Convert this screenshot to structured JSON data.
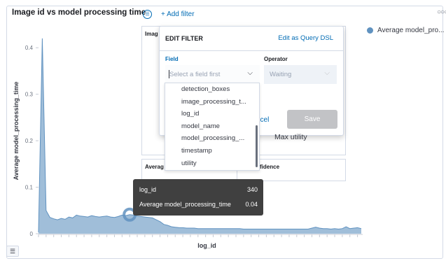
{
  "panel": {
    "title": "Image id vs model processing time",
    "dots": "○○○",
    "legend_toggle_icon": "list-icon"
  },
  "legend": {
    "label": "Average model_pro...",
    "color": "#6092c0"
  },
  "filter_bar": {
    "menu_icon": "filter-menu-icon",
    "add_filter": "+ Add filter"
  },
  "background_panels": {
    "top_left_title": "Imag",
    "bottom_left_title": "Averag",
    "bottom_right_title": "ge_confidence",
    "max_utility": "Max utility"
  },
  "edit_filter": {
    "title": "EDIT FILTER",
    "edit_dsl": "Edit as Query DSL",
    "field_label": "Field",
    "field_placeholder": "Select a field first",
    "operator_label": "Operator",
    "operator_placeholder": "Waiting",
    "cancel": "ncel",
    "save": "Save",
    "options": [
      "detection_boxes",
      "image_processing_t...",
      "log_id",
      "model_name",
      "model_processing_...",
      "timestamp",
      "utility"
    ]
  },
  "tooltip": {
    "row1_label": "log_id",
    "row1_value": "340",
    "row2_label": "Average model_processing_time",
    "row2_value": "0.04"
  },
  "chart_data": {
    "type": "area",
    "title": "Image id vs model processing time",
    "xlabel": "log_id",
    "ylabel": "Average model_processing_time",
    "ylim": [
      0,
      0.45
    ],
    "yticks": [
      0,
      0.1,
      0.2,
      0.3,
      0.4
    ],
    "series": [
      {
        "name": "Average model_processing_time",
        "values": [
          0.003,
          0.42,
          0.05,
          0.035,
          0.032,
          0.03,
          0.033,
          0.031,
          0.036,
          0.034,
          0.04,
          0.038,
          0.037,
          0.036,
          0.039,
          0.037,
          0.036,
          0.037,
          0.038,
          0.036,
          0.035,
          0.037,
          0.04,
          0.039,
          0.041,
          0.04,
          0.038,
          0.037,
          0.036,
          0.035,
          0.034,
          0.03,
          0.026,
          0.02,
          0.018,
          0.015,
          0.014,
          0.013,
          0.013,
          0.012,
          0.012,
          0.012,
          0.011,
          0.011,
          0.011,
          0.011,
          0.011,
          0.011,
          0.011,
          0.011,
          0.011,
          0.011,
          0.011,
          0.011,
          0.01,
          0.01,
          0.01,
          0.01,
          0.01,
          0.01,
          0.01,
          0.01,
          0.01,
          0.01,
          0.01,
          0.01,
          0.01,
          0.01,
          0.01,
          0.01,
          0.01,
          0.01,
          0.012,
          0.014,
          0.012,
          0.011,
          0.011,
          0.01,
          0.011,
          0.01,
          0.011,
          0.015,
          0.011,
          0.012,
          0.013,
          0.011
        ]
      }
    ],
    "highlight_index": 24,
    "grid": false
  }
}
